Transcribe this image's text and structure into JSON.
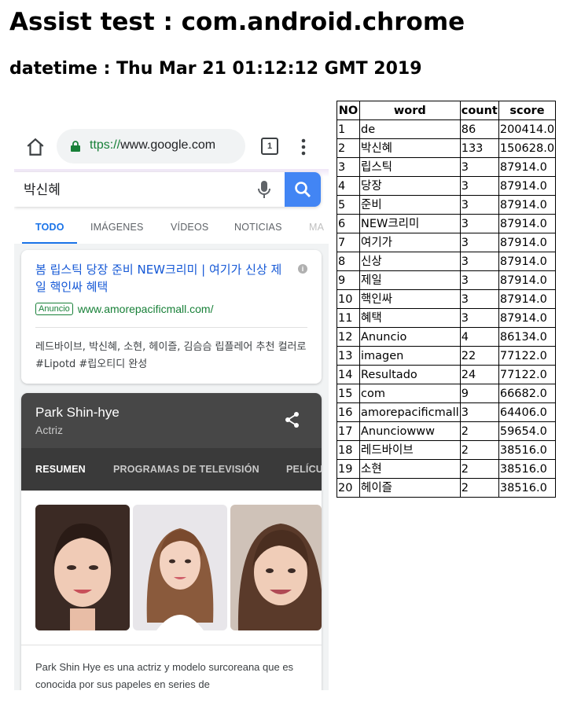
{
  "page": {
    "title": "Assist test : com.android.chrome",
    "datetime": "datetime : Thu Mar 21 01:12:12 GMT 2019"
  },
  "browser": {
    "url_scheme": "ttps://",
    "url_host": "www.google.com",
    "tab_count": "1"
  },
  "search": {
    "query": "박신혜",
    "tabs": [
      "TODO",
      "IMÁGENES",
      "VÍDEOS",
      "NOTICIAS",
      "MA"
    ]
  },
  "ad": {
    "title": "봄 립스틱 당장 준비 NEW크리미 | 여기가 신상 제일 핵인싸 혜택",
    "badge": "Anuncio",
    "url": "www.amorepacificmall.com/",
    "description": "레드바이브, 박신혜, 소현, 헤이즐, 김슴슴 립플레어 추천 컬러로 #Lipotd #립오티디 완성"
  },
  "knowledge_panel": {
    "name": "Park Shin-hye",
    "subtitle": "Actriz",
    "tabs": [
      "RESUMEN",
      "PROGRAMAS DE TELEVISIÓN",
      "PELÍCU"
    ],
    "description": "Park Shin Hye es una actriz y modelo surcoreana que es conocida por sus papeles en series de"
  },
  "colors": {
    "link": "#1558d6",
    "ad_green": "#188038",
    "google_blue": "#4285f4",
    "panel_dark": "#474747"
  },
  "table": {
    "headers": [
      "NO",
      "word",
      "count",
      "score"
    ],
    "rows": [
      [
        "1",
        "de",
        "86",
        "200414.0"
      ],
      [
        "2",
        "박신혜",
        "133",
        "150628.0"
      ],
      [
        "3",
        "립스틱",
        "3",
        "87914.0"
      ],
      [
        "4",
        "당장",
        "3",
        "87914.0"
      ],
      [
        "5",
        "준비",
        "3",
        "87914.0"
      ],
      [
        "6",
        "NEW크리미",
        "3",
        "87914.0"
      ],
      [
        "7",
        "여기가",
        "3",
        "87914.0"
      ],
      [
        "8",
        "신상",
        "3",
        "87914.0"
      ],
      [
        "9",
        "제일",
        "3",
        "87914.0"
      ],
      [
        "10",
        "핵인싸",
        "3",
        "87914.0"
      ],
      [
        "11",
        "혜택",
        "3",
        "87914.0"
      ],
      [
        "12",
        "Anuncio",
        "4",
        "86134.0"
      ],
      [
        "13",
        "imagen",
        "22",
        "77122.0"
      ],
      [
        "14",
        "Resultado",
        "24",
        "77122.0"
      ],
      [
        "15",
        "com",
        "9",
        "66682.0"
      ],
      [
        "16",
        "amorepacificmall",
        "3",
        "64406.0"
      ],
      [
        "17",
        "Anunciowww",
        "2",
        "59654.0"
      ],
      [
        "18",
        "레드바이브",
        "2",
        "38516.0"
      ],
      [
        "19",
        "소현",
        "2",
        "38516.0"
      ],
      [
        "20",
        "헤이즐",
        "2",
        "38516.0"
      ]
    ]
  }
}
